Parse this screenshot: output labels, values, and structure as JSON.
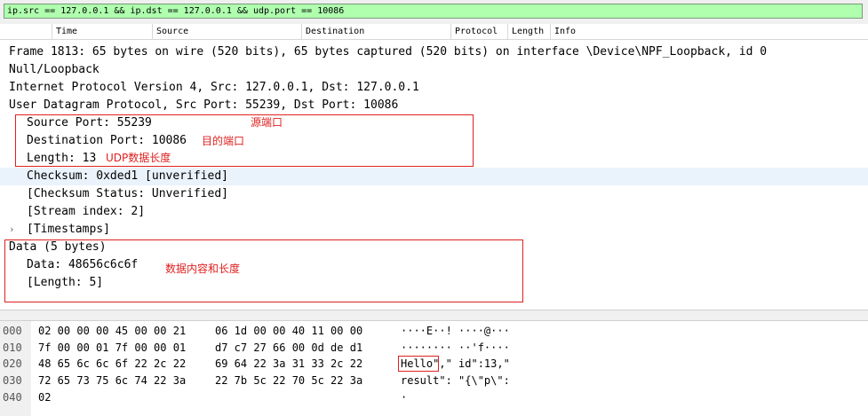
{
  "filter": {
    "value": "ip.src == 127.0.0.1 && ip.dst == 127.0.0.1 && udp.port == 10086"
  },
  "packet_list": {
    "columns": [
      "",
      "Time",
      "Source",
      "Destination",
      "Protocol",
      "Length",
      "Info"
    ]
  },
  "details": {
    "rows": [
      "Frame 1813: 65 bytes on wire (520 bits), 65 bytes captured (520 bits) on interface \\Device\\NPF_Loopback, id 0",
      "Null/Loopback",
      "Internet Protocol Version 4, Src: 127.0.0.1, Dst: 127.0.0.1",
      "User Datagram Protocol, Src Port: 55239, Dst Port: 10086",
      "Source Port: 55239",
      "Destination Port: 10086",
      "Length: 13",
      "Checksum: 0xded1 [unverified]",
      "[Checksum Status: Unverified]",
      "[Stream index: 2]",
      "[Timestamps]",
      "Data (5 bytes)",
      "Data: 48656c6c6f",
      "[Length: 5]"
    ],
    "expander_glyph": "›"
  },
  "annotations": {
    "source_port": "源端口",
    "dest_port": "目的端口",
    "udp_length": "UDP数据长度",
    "data_info": "数据内容和长度"
  },
  "hex": {
    "rows": [
      {
        "offset": "000",
        "a": "02 00 00 00 45 00 00 21",
        "b": "06 1d 00 00 40 11 00 00",
        "ascii": "····E··! ····@···"
      },
      {
        "offset": "010",
        "a": "7f 00 00 01 7f 00 00 01",
        "b": "d7 c7 27 66 00 0d de d1",
        "ascii": "········ ··'f····"
      },
      {
        "offset": "020",
        "a": "48 65 6c 6c 6f 22 2c 22",
        "b": "69 64 22 3a 31 33 2c 22",
        "ascii": "Hello\",\" id\":13,\""
      },
      {
        "offset": "030",
        "a": "72 65 73 75 6c 74 22 3a",
        "b": "22 7b 5c 22 70 5c 22 3a",
        "ascii": "result\": \"{\\\"p\\\":"
      },
      {
        "offset": "040",
        "a": "02",
        "b": "",
        "ascii": "·"
      }
    ]
  },
  "colors": {
    "filter_ok": "#afffaf",
    "highlight": "#e02020",
    "selected_row": "#eaf2fb"
  }
}
